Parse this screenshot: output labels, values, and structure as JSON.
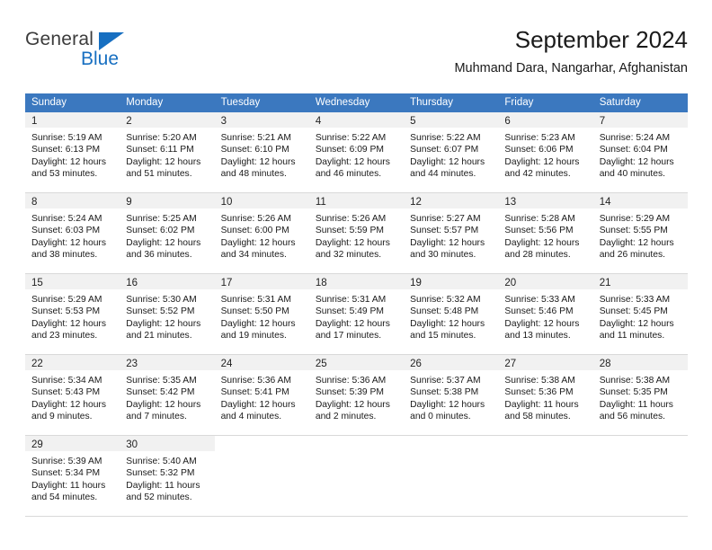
{
  "logo": {
    "word_one": "General",
    "word_two": "Blue",
    "triangle": "blue-triangle-icon"
  },
  "header": {
    "title": "September 2024",
    "subtitle": "Muhmand Dara, Nangarhar, Afghanistan"
  },
  "colors": {
    "header_blue": "#3b78bf",
    "logo_blue": "#176fc1",
    "daynum_band": "#f1f1f1",
    "grid_line": "#d9d9d9"
  },
  "weekdays": [
    "Sunday",
    "Monday",
    "Tuesday",
    "Wednesday",
    "Thursday",
    "Friday",
    "Saturday"
  ],
  "weeks": [
    [
      {
        "day": "1",
        "sunrise": "Sunrise: 5:19 AM",
        "sunset": "Sunset: 6:13 PM",
        "daylight1": "Daylight: 12 hours",
        "daylight2": "and 53 minutes."
      },
      {
        "day": "2",
        "sunrise": "Sunrise: 5:20 AM",
        "sunset": "Sunset: 6:11 PM",
        "daylight1": "Daylight: 12 hours",
        "daylight2": "and 51 minutes."
      },
      {
        "day": "3",
        "sunrise": "Sunrise: 5:21 AM",
        "sunset": "Sunset: 6:10 PM",
        "daylight1": "Daylight: 12 hours",
        "daylight2": "and 48 minutes."
      },
      {
        "day": "4",
        "sunrise": "Sunrise: 5:22 AM",
        "sunset": "Sunset: 6:09 PM",
        "daylight1": "Daylight: 12 hours",
        "daylight2": "and 46 minutes."
      },
      {
        "day": "5",
        "sunrise": "Sunrise: 5:22 AM",
        "sunset": "Sunset: 6:07 PM",
        "daylight1": "Daylight: 12 hours",
        "daylight2": "and 44 minutes."
      },
      {
        "day": "6",
        "sunrise": "Sunrise: 5:23 AM",
        "sunset": "Sunset: 6:06 PM",
        "daylight1": "Daylight: 12 hours",
        "daylight2": "and 42 minutes."
      },
      {
        "day": "7",
        "sunrise": "Sunrise: 5:24 AM",
        "sunset": "Sunset: 6:04 PM",
        "daylight1": "Daylight: 12 hours",
        "daylight2": "and 40 minutes."
      }
    ],
    [
      {
        "day": "8",
        "sunrise": "Sunrise: 5:24 AM",
        "sunset": "Sunset: 6:03 PM",
        "daylight1": "Daylight: 12 hours",
        "daylight2": "and 38 minutes."
      },
      {
        "day": "9",
        "sunrise": "Sunrise: 5:25 AM",
        "sunset": "Sunset: 6:02 PM",
        "daylight1": "Daylight: 12 hours",
        "daylight2": "and 36 minutes."
      },
      {
        "day": "10",
        "sunrise": "Sunrise: 5:26 AM",
        "sunset": "Sunset: 6:00 PM",
        "daylight1": "Daylight: 12 hours",
        "daylight2": "and 34 minutes."
      },
      {
        "day": "11",
        "sunrise": "Sunrise: 5:26 AM",
        "sunset": "Sunset: 5:59 PM",
        "daylight1": "Daylight: 12 hours",
        "daylight2": "and 32 minutes."
      },
      {
        "day": "12",
        "sunrise": "Sunrise: 5:27 AM",
        "sunset": "Sunset: 5:57 PM",
        "daylight1": "Daylight: 12 hours",
        "daylight2": "and 30 minutes."
      },
      {
        "day": "13",
        "sunrise": "Sunrise: 5:28 AM",
        "sunset": "Sunset: 5:56 PM",
        "daylight1": "Daylight: 12 hours",
        "daylight2": "and 28 minutes."
      },
      {
        "day": "14",
        "sunrise": "Sunrise: 5:29 AM",
        "sunset": "Sunset: 5:55 PM",
        "daylight1": "Daylight: 12 hours",
        "daylight2": "and 26 minutes."
      }
    ],
    [
      {
        "day": "15",
        "sunrise": "Sunrise: 5:29 AM",
        "sunset": "Sunset: 5:53 PM",
        "daylight1": "Daylight: 12 hours",
        "daylight2": "and 23 minutes."
      },
      {
        "day": "16",
        "sunrise": "Sunrise: 5:30 AM",
        "sunset": "Sunset: 5:52 PM",
        "daylight1": "Daylight: 12 hours",
        "daylight2": "and 21 minutes."
      },
      {
        "day": "17",
        "sunrise": "Sunrise: 5:31 AM",
        "sunset": "Sunset: 5:50 PM",
        "daylight1": "Daylight: 12 hours",
        "daylight2": "and 19 minutes."
      },
      {
        "day": "18",
        "sunrise": "Sunrise: 5:31 AM",
        "sunset": "Sunset: 5:49 PM",
        "daylight1": "Daylight: 12 hours",
        "daylight2": "and 17 minutes."
      },
      {
        "day": "19",
        "sunrise": "Sunrise: 5:32 AM",
        "sunset": "Sunset: 5:48 PM",
        "daylight1": "Daylight: 12 hours",
        "daylight2": "and 15 minutes."
      },
      {
        "day": "20",
        "sunrise": "Sunrise: 5:33 AM",
        "sunset": "Sunset: 5:46 PM",
        "daylight1": "Daylight: 12 hours",
        "daylight2": "and 13 minutes."
      },
      {
        "day": "21",
        "sunrise": "Sunrise: 5:33 AM",
        "sunset": "Sunset: 5:45 PM",
        "daylight1": "Daylight: 12 hours",
        "daylight2": "and 11 minutes."
      }
    ],
    [
      {
        "day": "22",
        "sunrise": "Sunrise: 5:34 AM",
        "sunset": "Sunset: 5:43 PM",
        "daylight1": "Daylight: 12 hours",
        "daylight2": "and 9 minutes."
      },
      {
        "day": "23",
        "sunrise": "Sunrise: 5:35 AM",
        "sunset": "Sunset: 5:42 PM",
        "daylight1": "Daylight: 12 hours",
        "daylight2": "and 7 minutes."
      },
      {
        "day": "24",
        "sunrise": "Sunrise: 5:36 AM",
        "sunset": "Sunset: 5:41 PM",
        "daylight1": "Daylight: 12 hours",
        "daylight2": "and 4 minutes."
      },
      {
        "day": "25",
        "sunrise": "Sunrise: 5:36 AM",
        "sunset": "Sunset: 5:39 PM",
        "daylight1": "Daylight: 12 hours",
        "daylight2": "and 2 minutes."
      },
      {
        "day": "26",
        "sunrise": "Sunrise: 5:37 AM",
        "sunset": "Sunset: 5:38 PM",
        "daylight1": "Daylight: 12 hours",
        "daylight2": "and 0 minutes."
      },
      {
        "day": "27",
        "sunrise": "Sunrise: 5:38 AM",
        "sunset": "Sunset: 5:36 PM",
        "daylight1": "Daylight: 11 hours",
        "daylight2": "and 58 minutes."
      },
      {
        "day": "28",
        "sunrise": "Sunrise: 5:38 AM",
        "sunset": "Sunset: 5:35 PM",
        "daylight1": "Daylight: 11 hours",
        "daylight2": "and 56 minutes."
      }
    ],
    [
      {
        "day": "29",
        "sunrise": "Sunrise: 5:39 AM",
        "sunset": "Sunset: 5:34 PM",
        "daylight1": "Daylight: 11 hours",
        "daylight2": "and 54 minutes."
      },
      {
        "day": "30",
        "sunrise": "Sunrise: 5:40 AM",
        "sunset": "Sunset: 5:32 PM",
        "daylight1": "Daylight: 11 hours",
        "daylight2": "and 52 minutes."
      },
      {
        "day": "",
        "sunrise": "",
        "sunset": "",
        "daylight1": "",
        "daylight2": ""
      },
      {
        "day": "",
        "sunrise": "",
        "sunset": "",
        "daylight1": "",
        "daylight2": ""
      },
      {
        "day": "",
        "sunrise": "",
        "sunset": "",
        "daylight1": "",
        "daylight2": ""
      },
      {
        "day": "",
        "sunrise": "",
        "sunset": "",
        "daylight1": "",
        "daylight2": ""
      },
      {
        "day": "",
        "sunrise": "",
        "sunset": "",
        "daylight1": "",
        "daylight2": ""
      }
    ]
  ]
}
